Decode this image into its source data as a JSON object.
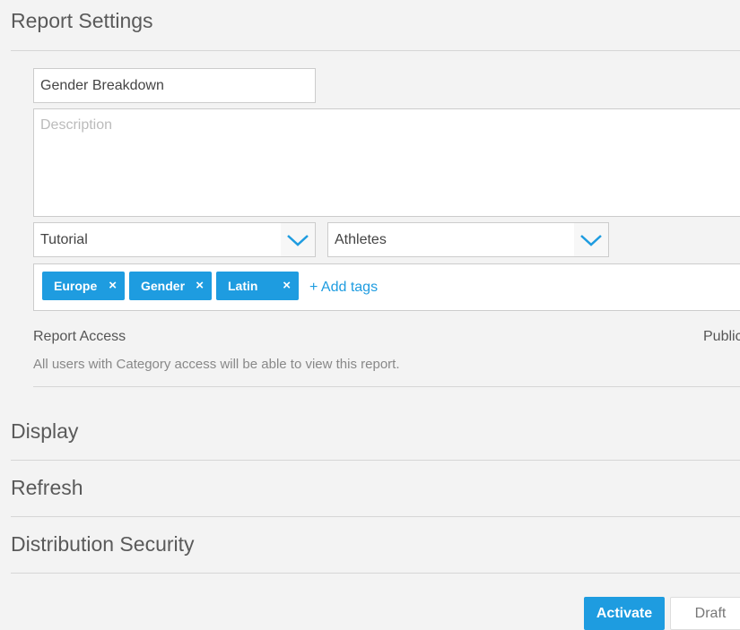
{
  "header": {
    "title": "Report Settings"
  },
  "form": {
    "name_value": "Gender Breakdown",
    "description_placeholder": "Description",
    "category_select": "Tutorial",
    "subcategory_select": "Athletes",
    "tags": [
      {
        "label": "Europe"
      },
      {
        "label": "Gender"
      },
      {
        "label": "Latin"
      }
    ],
    "remove_icon": "×",
    "add_tags_label": "+ Add tags"
  },
  "access": {
    "label": "Report Access",
    "value": "Public",
    "description": "All users with Category access will be able to view this report."
  },
  "sections": [
    {
      "label": "Display"
    },
    {
      "label": "Refresh"
    },
    {
      "label": "Distribution Security"
    }
  ],
  "footer": {
    "activate_label": "Activate",
    "draft_label": "Draft"
  },
  "colors": {
    "accent": "#1e9ce0",
    "background": "#f3f3f3"
  }
}
